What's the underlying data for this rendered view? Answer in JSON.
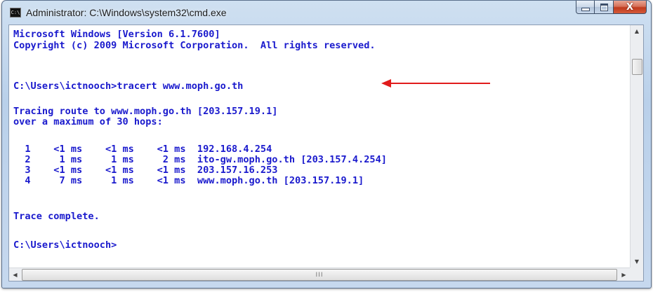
{
  "window": {
    "title": "Administrator: C:\\Windows\\system32\\cmd.exe",
    "icon": "cmd-icon",
    "icon_glyph": "C:\\",
    "controls": {
      "close_glyph": "X"
    }
  },
  "console": {
    "lines": [
      "Microsoft Windows [Version 6.1.7600]",
      "Copyright (c) 2009 Microsoft Corporation.  All rights reserved.",
      "",
      "C:\\Users\\ictnooch>tracert www.moph.go.th",
      "",
      "Tracing route to www.moph.go.th [203.157.19.1]",
      "over a maximum of 30 hops:",
      "",
      "  1    <1 ms    <1 ms    <1 ms  192.168.4.254",
      "  2     1 ms     1 ms     2 ms  ito-gw.moph.go.th [203.157.4.254]",
      "  3    <1 ms    <1 ms    <1 ms  203.157.16.253",
      "  4     7 ms     1 ms    <1 ms  www.moph.go.th [203.157.19.1]",
      "",
      "Trace complete.",
      "",
      "C:\\Users\\ictnooch>"
    ],
    "text_color": "#1a1acd",
    "background": "#ffffff"
  },
  "annotation": {
    "arrow_color": "#e11b1b",
    "arrow_icon": "red-arrow-left-icon"
  },
  "scrollbar": {
    "grip_glyph": "III"
  }
}
